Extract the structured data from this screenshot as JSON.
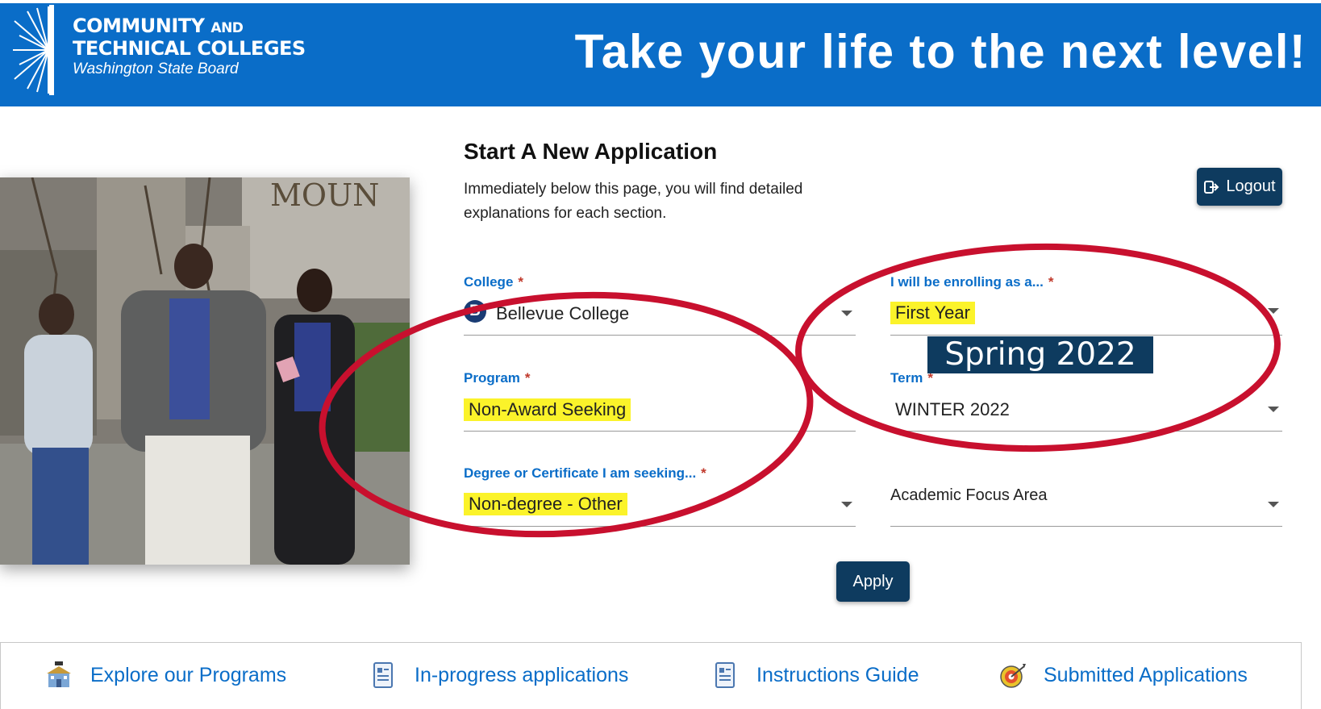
{
  "header": {
    "logo_line1": "COMMUNITY",
    "logo_line1_small": "AND",
    "logo_line2": "TECHNICAL COLLEGES",
    "logo_line3": "Washington State Board",
    "tagline": "Take your life to the next level!"
  },
  "form": {
    "title": "Start A New Application",
    "description": "Immediately below this page, you will find detailed explanations for each section.",
    "logout_label": "Logout",
    "required_mark": "*",
    "college": {
      "label": "College",
      "value": "Bellevue College",
      "icon_letter": "B"
    },
    "enrolling_as": {
      "label": "I will be enrolling as a...",
      "value": "First Year"
    },
    "program": {
      "label": "Program",
      "value": "Non-Award Seeking"
    },
    "term": {
      "label": "Term",
      "value": "WINTER 2022"
    },
    "degree": {
      "label": "Degree or Certificate I am seeking...",
      "value": "Non-degree - Other"
    },
    "focus_area": {
      "placeholder": "Academic Focus Area"
    },
    "apply_label": "Apply"
  },
  "annotation": {
    "overlay_text": "Spring 2022"
  },
  "photo": {
    "sign_text": "MOUN"
  },
  "footer": {
    "links": [
      {
        "label": "Explore our Programs",
        "icon": "school-building-icon"
      },
      {
        "label": "In-progress applications",
        "icon": "document-icon"
      },
      {
        "label": "Instructions Guide",
        "icon": "document-icon"
      },
      {
        "label": "Submitted Applications",
        "icon": "target-icon"
      }
    ]
  },
  "colors": {
    "header_blue": "#0a6dc8",
    "navy_button": "#0e3b5f",
    "label_blue": "#0a6dc8",
    "required_red": "#c0392b",
    "highlight_yellow": "#fbf32a",
    "annotation_red": "#c8102e"
  }
}
